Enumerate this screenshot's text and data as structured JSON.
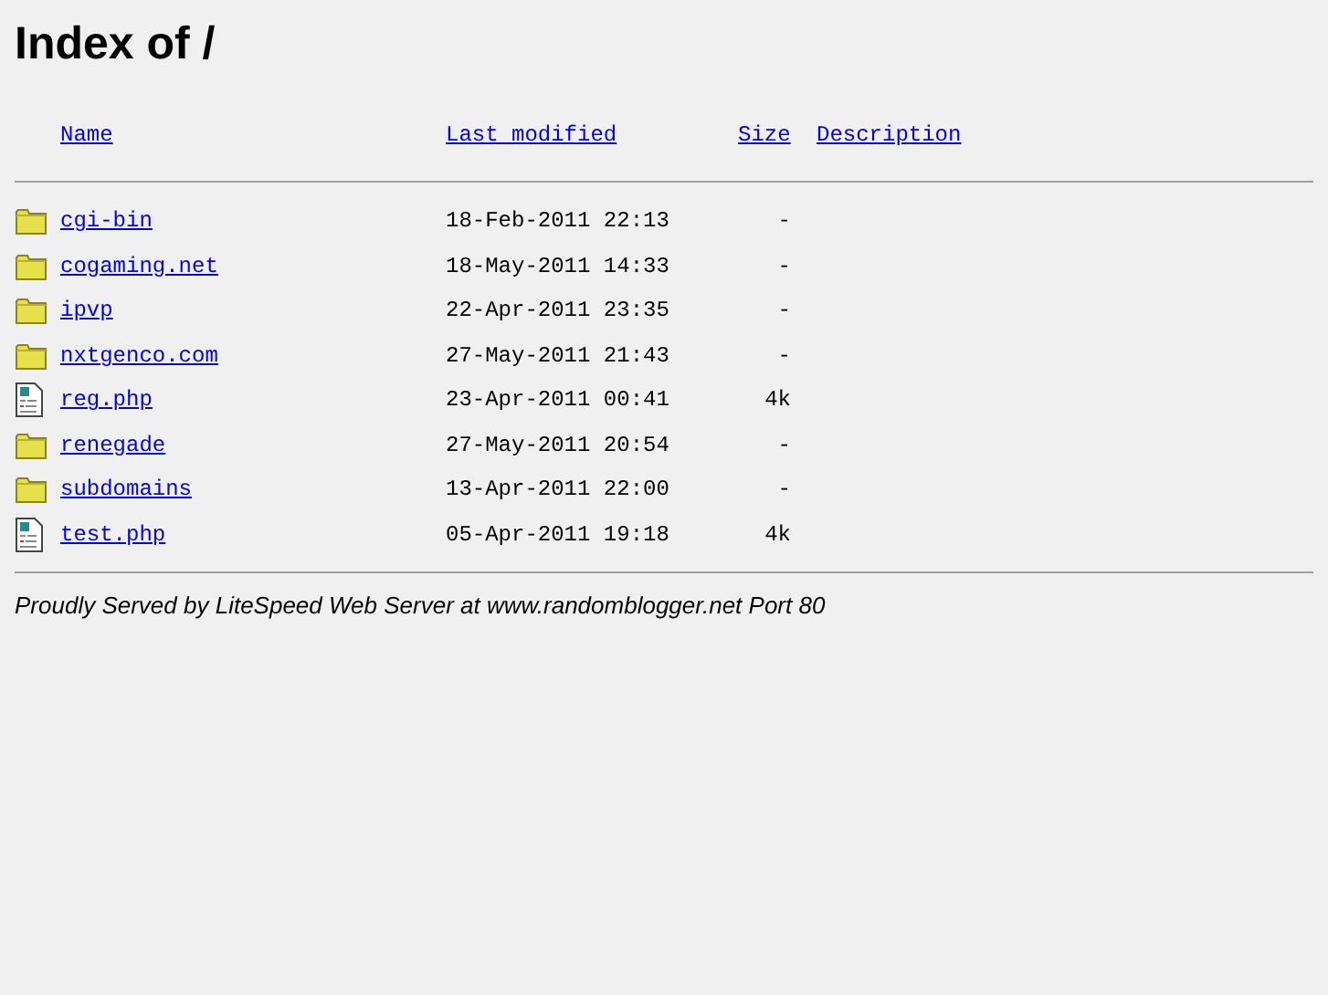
{
  "title": "Index of /",
  "columns": [
    "Name",
    "Last modified",
    "Size",
    "Description"
  ],
  "rows": [
    {
      "kind": "folder",
      "name": "cgi-bin",
      "modified": "18-Feb-2011 22:13",
      "size": "-"
    },
    {
      "kind": "folder",
      "name": "cogaming.net",
      "modified": "18-May-2011 14:33",
      "size": "-"
    },
    {
      "kind": "folder",
      "name": "ipvp",
      "modified": "22-Apr-2011 23:35",
      "size": "-"
    },
    {
      "kind": "folder",
      "name": "nxtgenco.com",
      "modified": "27-May-2011 21:43",
      "size": "-"
    },
    {
      "kind": "file",
      "name": "reg.php",
      "modified": "23-Apr-2011 00:41",
      "size": "4k"
    },
    {
      "kind": "folder",
      "name": "renegade",
      "modified": "27-May-2011 20:54",
      "size": "-"
    },
    {
      "kind": "folder",
      "name": "subdomains",
      "modified": "13-Apr-2011 22:00",
      "size": "-"
    },
    {
      "kind": "file",
      "name": "test.php",
      "modified": "05-Apr-2011 19:18",
      "size": "4k"
    }
  ],
  "footer": "Proudly Served by LiteSpeed Web Server at www.randomblogger.net Port 80"
}
